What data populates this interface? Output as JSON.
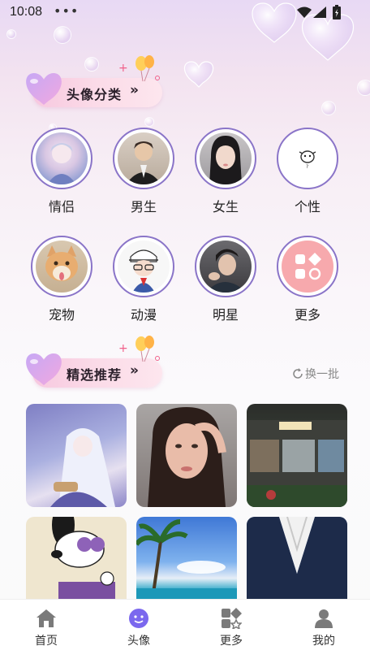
{
  "status_bar": {
    "time": "10:08",
    "dots": "•••"
  },
  "sections": {
    "categories_title": "头像分类",
    "featured_title": "精选推荐",
    "chevron": "»"
  },
  "categories": [
    {
      "label": "情侣",
      "icon": "couple-avatar"
    },
    {
      "label": "男生",
      "icon": "male-avatar"
    },
    {
      "label": "女生",
      "icon": "female-avatar"
    },
    {
      "label": "个性",
      "icon": "personality-avatar"
    },
    {
      "label": "宠物",
      "icon": "pet-avatar"
    },
    {
      "label": "动漫",
      "icon": "anime-avatar"
    },
    {
      "label": "明星",
      "icon": "star-avatar"
    },
    {
      "label": "更多",
      "icon": "more-grid-icon"
    }
  ],
  "refresh": {
    "label": "换一批",
    "icon": "refresh-icon"
  },
  "featured_images": [
    {
      "name": "anime-girl-image"
    },
    {
      "name": "portrait-woman-image"
    },
    {
      "name": "night-train-image"
    },
    {
      "name": "snoopy-image"
    },
    {
      "name": "beach-palm-image"
    },
    {
      "name": "denim-shirt-image"
    }
  ],
  "tabbar": {
    "items": [
      {
        "label": "首页",
        "icon": "home-icon",
        "active": false
      },
      {
        "label": "头像",
        "icon": "avatar-face-icon",
        "active": true
      },
      {
        "label": "更多",
        "icon": "apps-icon",
        "active": false
      },
      {
        "label": "我的",
        "icon": "profile-icon",
        "active": false
      }
    ]
  },
  "colors": {
    "accent": "#8a74c8",
    "active_tab": "#7b68ee",
    "pill_pink": "#f7c8df"
  }
}
